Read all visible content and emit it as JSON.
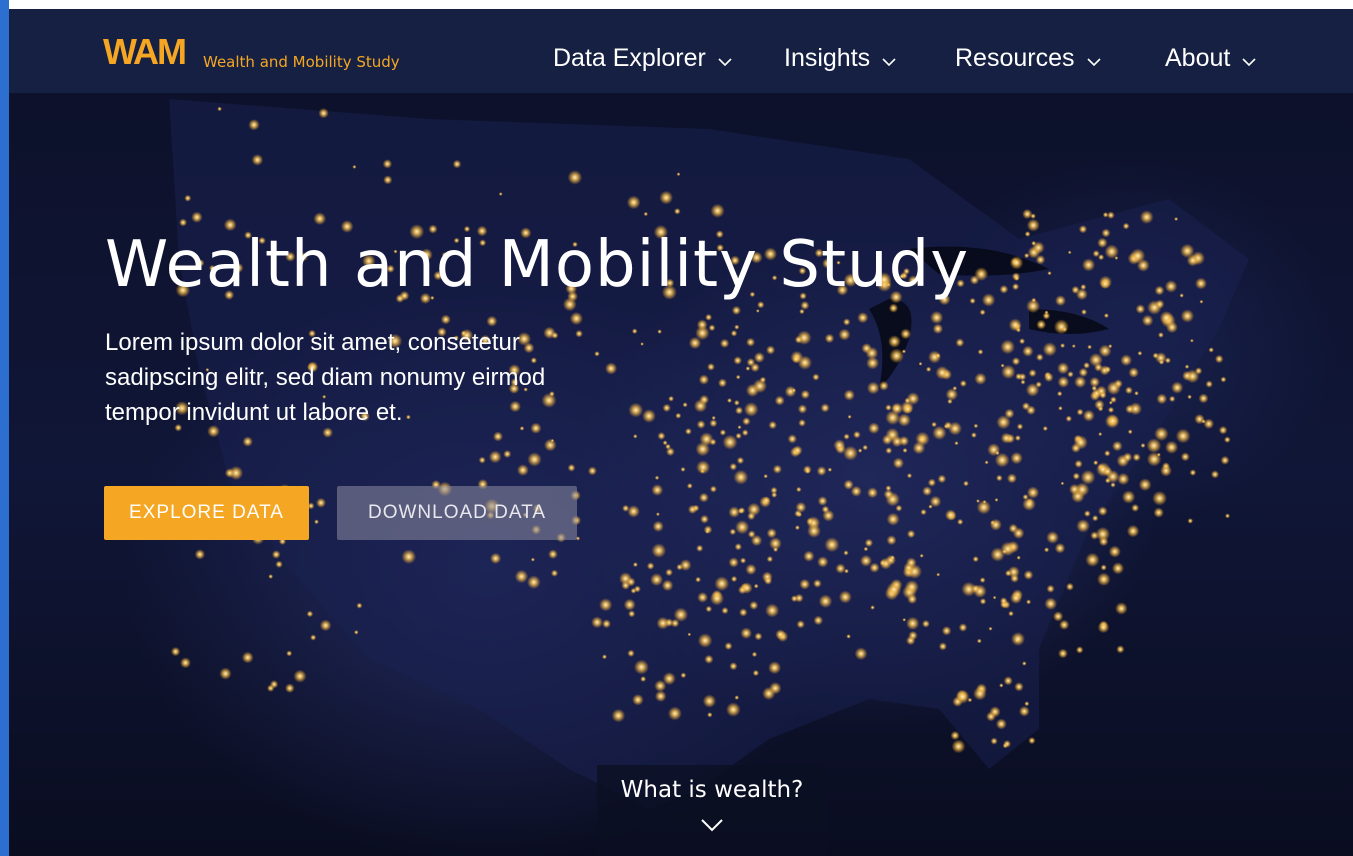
{
  "brand": {
    "logo": "WAM",
    "tagline": "Wealth and Mobility Study",
    "accent_color": "#f5a623"
  },
  "nav": {
    "items": [
      {
        "label": "Data Explorer"
      },
      {
        "label": "Insights"
      },
      {
        "label": "Resources"
      },
      {
        "label": "About"
      }
    ],
    "chevron_icon": "chevron-down-icon"
  },
  "hero": {
    "title": "Wealth and Mobility Study",
    "subtitle": "Lorem ipsum dolor sit amet, consetetur sadipscing elitr, sed diam nonumy eirmod tempor invidunt ut labore et.",
    "background": "night-lights-map-of-united-states"
  },
  "buttons": {
    "primary": "EXPLORE DATA",
    "secondary": "DOWNLOAD DATA"
  },
  "scroll_prompt": {
    "label": "What is wealth?",
    "icon": "chevron-down-icon"
  }
}
